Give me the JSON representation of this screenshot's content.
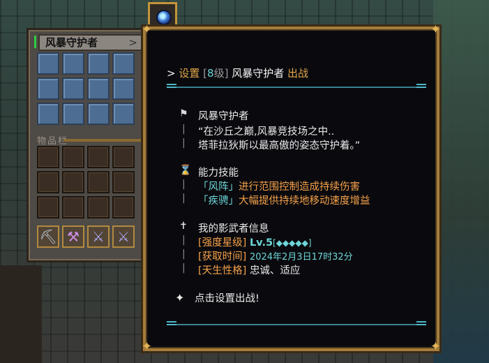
{
  "inventory": {
    "title": "风暴守护者",
    "title_chevron": ">",
    "items_label": "物品栏",
    "tools": [
      "shovel-icon",
      "pickaxe-icon",
      "sword-icon",
      "sword-icon"
    ]
  },
  "tooltip": {
    "header": {
      "prefix": ">",
      "action": "设置",
      "level_open": "[",
      "level": "8",
      "level_close": "级]",
      "name": "风暴守护者",
      "status": "出战"
    },
    "identity": {
      "name": "风暴守护者",
      "quote_line1": "“在沙丘之巅,风暴竞技场之中..",
      "quote_line2": "塔菲拉狄斯以最高傲的姿态守护着。”"
    },
    "skills": {
      "title": "能力技能",
      "skill1_name": "「风阵」",
      "skill1_desc": "进行范围控制造成持续伤害",
      "skill2_name": "「疾骋」",
      "skill2_desc": "大幅提供持续地移动速度增益"
    },
    "info": {
      "title": "我的影武者信息",
      "star_label": "[强度星级]",
      "star_value": "Lv.5",
      "stars": "[◆◆◆◆◆]",
      "time_label": "[获取时间]",
      "time_value": "2024年2月3日17时32分",
      "nature_label": "[天生性格]",
      "nature_value": "忠诚、适应"
    },
    "action_hint": "点击设置出战!"
  },
  "colors": {
    "gold": "#e0a74a",
    "cyan": "#6dd5d8",
    "orange": "#f5a14b",
    "frame": "#a57d3a"
  }
}
